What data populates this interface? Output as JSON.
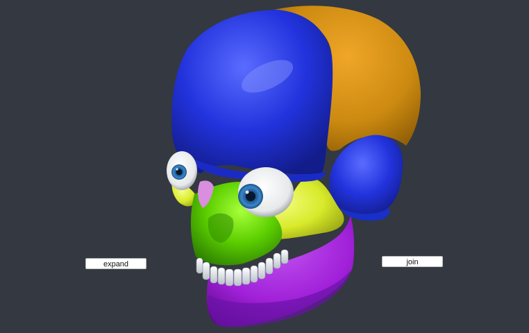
{
  "viewer": {
    "background": "#343841",
    "model": "skull-3d-model",
    "bone_colors": {
      "parietal": "#2233dd",
      "occipital": "#cc8a10",
      "temporal": "#1e3ad8",
      "maxilla": "#5ccf00",
      "zygomatic": "#d8ea2a",
      "nasal": "#d98ee0",
      "mandible": "#a020d8",
      "teeth": "#e8ecef",
      "iris": "#3a88c8"
    }
  },
  "controls": {
    "expand_label": "expand",
    "join_label": "join"
  }
}
